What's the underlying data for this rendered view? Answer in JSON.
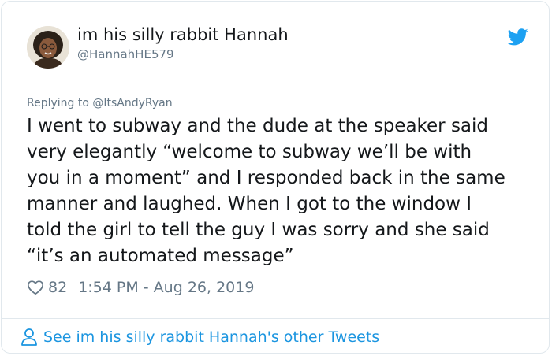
{
  "user": {
    "display_name": "im his silly rabbit Hannah",
    "handle": "@HannahHE579",
    "avatar_icon": "avatar"
  },
  "brand": {
    "icon": "twitter-bird-icon",
    "color": "#1da1f2"
  },
  "reply": {
    "prefix": "Replying to ",
    "mention": "@ItsAndyRyan"
  },
  "tweet": {
    "lines": [
      "I went to subway and the dude at the speaker said",
      "very elegantly “welcome to subway we’ll be with",
      "you in a moment” and I responded back in the same",
      "manner and laughed. When I got to the window I",
      "told the girl to tell the guy I was sorry and she said",
      "“it’s an automated message”"
    ]
  },
  "meta": {
    "likes": "82",
    "timestamp": "1:54 PM - Aug 26, 2019"
  },
  "footer": {
    "link_text": "See im his silly rabbit Hannah's other Tweets",
    "link_color": "#1b95e0"
  }
}
